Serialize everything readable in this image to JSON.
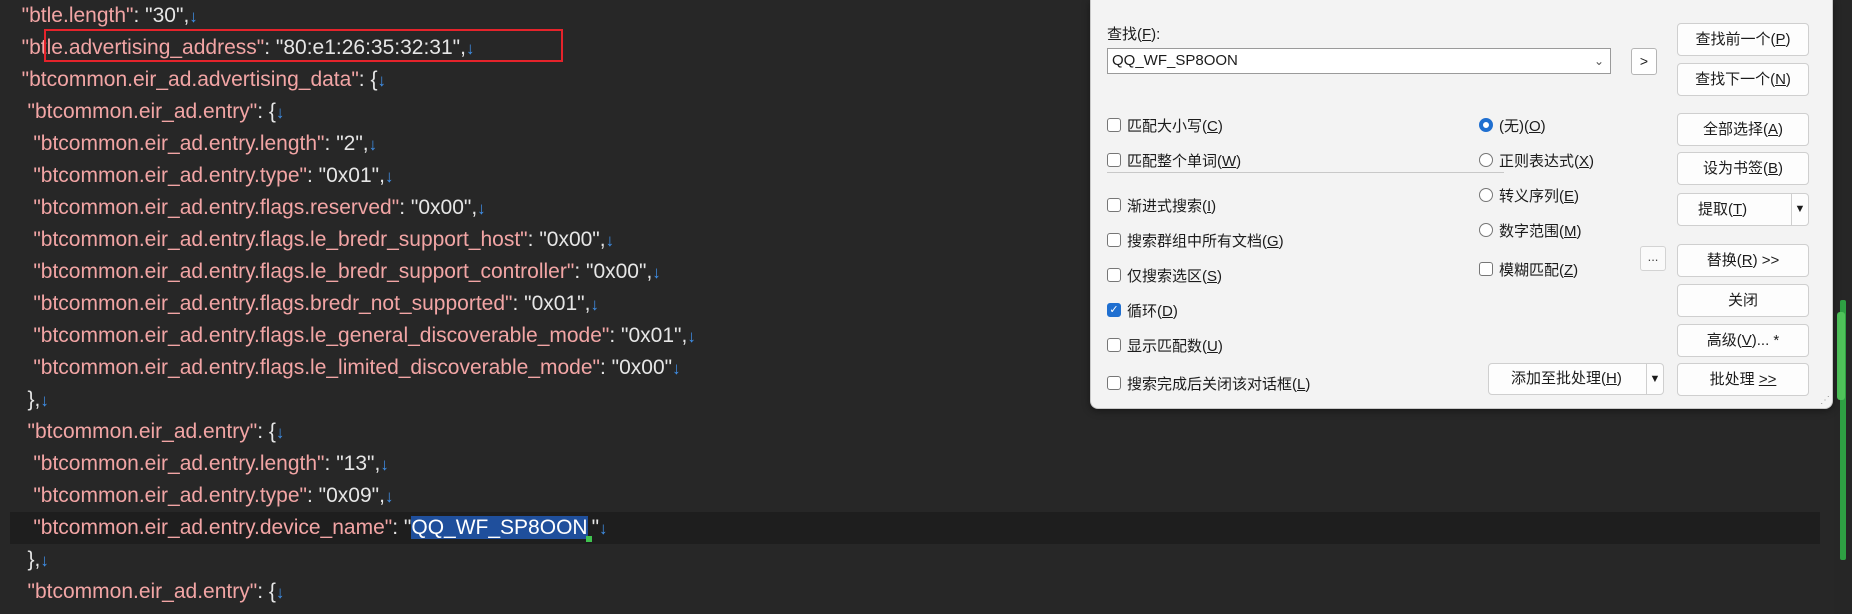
{
  "editor": {
    "lines": [
      {
        "indent": "  ",
        "key": "btle.length",
        "sep": ": ",
        "value": "\"30\"",
        "tail": ","
      },
      {
        "indent": "  ",
        "key": "btle.advertising_address",
        "sep": ": ",
        "value": "\"80:e1:26:35:32:31\"",
        "tail": ","
      },
      {
        "indent": "  ",
        "key": "btcommon.eir_ad.advertising_data",
        "sep": ": ",
        "value": "{",
        "tail": ""
      },
      {
        "indent": "   ",
        "key": "btcommon.eir_ad.entry",
        "sep": ": ",
        "value": "{",
        "tail": ""
      },
      {
        "indent": "    ",
        "key": "btcommon.eir_ad.entry.length",
        "sep": ": ",
        "value": "\"2\"",
        "tail": ","
      },
      {
        "indent": "    ",
        "key": "btcommon.eir_ad.entry.type",
        "sep": ": ",
        "value": "\"0x01\"",
        "tail": ","
      },
      {
        "indent": "    ",
        "key": "btcommon.eir_ad.entry.flags.reserved",
        "sep": ": ",
        "value": "\"0x00\"",
        "tail": ","
      },
      {
        "indent": "    ",
        "key": "btcommon.eir_ad.entry.flags.le_bredr_support_host",
        "sep": ": ",
        "value": "\"0x00\"",
        "tail": ","
      },
      {
        "indent": "    ",
        "key": "btcommon.eir_ad.entry.flags.le_bredr_support_controller",
        "sep": ": ",
        "value": "\"0x00\"",
        "tail": ","
      },
      {
        "indent": "    ",
        "key": "btcommon.eir_ad.entry.flags.bredr_not_supported",
        "sep": ": ",
        "value": "\"0x01\"",
        "tail": ","
      },
      {
        "indent": "    ",
        "key": "btcommon.eir_ad.entry.flags.le_general_discoverable_mode",
        "sep": ": ",
        "value": "\"0x01\"",
        "tail": ","
      },
      {
        "indent": "    ",
        "key": "btcommon.eir_ad.entry.flags.le_limited_discoverable_mode",
        "sep": ": ",
        "value": "\"0x00\"",
        "tail": ""
      },
      {
        "indent": "   ",
        "key": "",
        "sep": "",
        "value": "},",
        "tail": ""
      },
      {
        "indent": "   ",
        "key": "btcommon.eir_ad.entry",
        "sep": ": ",
        "value": "{",
        "tail": ""
      },
      {
        "indent": "    ",
        "key": "btcommon.eir_ad.entry.length",
        "sep": ": ",
        "value": "\"13\"",
        "tail": ","
      },
      {
        "indent": "    ",
        "key": "btcommon.eir_ad.entry.type",
        "sep": ": ",
        "value": "\"0x09\"",
        "tail": ","
      },
      {
        "indent": "    ",
        "key": "btcommon.eir_ad.entry.device_name",
        "sep": ": ",
        "value": "\"",
        "selected": "QQ_WF_SP8OON",
        "tail": "\""
      },
      {
        "indent": "   ",
        "key": "",
        "sep": "",
        "value": "},",
        "tail": ""
      },
      {
        "indent": "   ",
        "key": "btcommon.eir_ad.entry",
        "sep": ": ",
        "value": "{",
        "tail": ""
      }
    ],
    "eol_marker": "↓",
    "current_line": 16,
    "highlighted_line": 1,
    "highlight_color": "#e5232b"
  },
  "find_dialog": {
    "find_label": "查找(",
    "find_hotkey": "F",
    "find_label_end": "):",
    "search_value": "QQ_WF_SP8OON",
    "expand_label": ">",
    "options_left": [
      {
        "label": "匹配大小写(",
        "hotkey": "C",
        "checked": false
      },
      {
        "label": "匹配整个单词(",
        "hotkey": "W",
        "checked": false
      },
      {
        "label": "渐进式搜索(",
        "hotkey": "I",
        "checked": false
      },
      {
        "label": "搜索群组中所有文档(",
        "hotkey": "G",
        "checked": false
      },
      {
        "label": "仅搜索选区(",
        "hotkey": "S",
        "checked": false
      },
      {
        "label": "循环(",
        "hotkey": "D",
        "checked": true
      },
      {
        "label": "显示匹配数(",
        "hotkey": "U",
        "checked": false
      },
      {
        "label": "搜索完成后关闭该对话框(",
        "hotkey": "L",
        "checked": false
      }
    ],
    "options_right": [
      {
        "label": "(无)(",
        "hotkey": "O",
        "selected": true
      },
      {
        "label": "正则表达式(",
        "hotkey": "X",
        "selected": false
      },
      {
        "label": "转义序列(",
        "hotkey": "E",
        "selected": false
      },
      {
        "label": "数字范围(",
        "hotkey": "M",
        "selected": false
      }
    ],
    "fuzzy": {
      "label": "模糊匹配(",
      "hotkey": "Z",
      "checked": false
    },
    "ellipsis_label": "...",
    "batch_add": {
      "label": "添加至批处理(",
      "hotkey": "H"
    },
    "buttons": [
      {
        "label": "查找前一个(",
        "hotkey": "P",
        "end": ")"
      },
      {
        "label": "查找下一个(",
        "hotkey": "N",
        "end": ")"
      },
      {
        "label": "全部选择(",
        "hotkey": "A",
        "end": ")"
      },
      {
        "label": "设为书签(",
        "hotkey": "B",
        "end": ")"
      },
      {
        "label": "提取(",
        "hotkey": "T",
        "end": ")"
      },
      {
        "label": "替换(",
        "hotkey": "R",
        "end": ") >>"
      },
      {
        "label": "关闭",
        "hotkey": "",
        "end": ""
      },
      {
        "label": "高级(",
        "hotkey": "V",
        "end": ")... *"
      },
      {
        "label": "批处理 ",
        "hotkey": ">>",
        "end": ""
      }
    ]
  }
}
